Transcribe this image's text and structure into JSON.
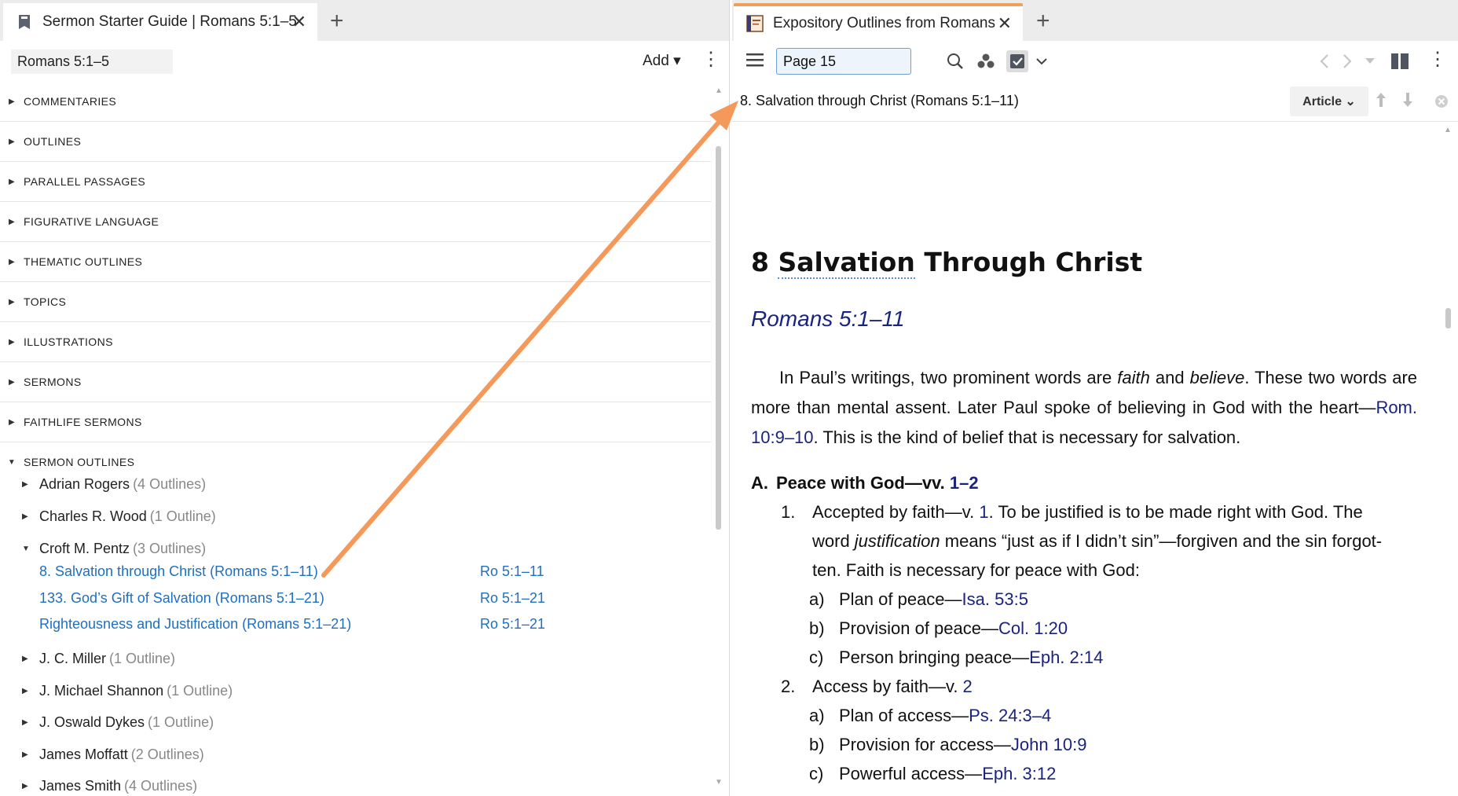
{
  "left": {
    "tab_title": "Sermon Starter Guide | Romans 5:1–5",
    "tab_close": "✕",
    "new_tab": "+",
    "passage": "Romans 5:1–5",
    "add_label": "Add ▾",
    "sections": [
      "COMMENTARIES",
      "OUTLINES",
      "PARALLEL PASSAGES",
      "FIGURATIVE LANGUAGE",
      "THEMATIC OUTLINES",
      "TOPICS",
      "ILLUSTRATIONS",
      "SERMONS",
      "FAITHLIFE SERMONS",
      "SERMON OUTLINES"
    ],
    "authors": [
      {
        "name": "Adrian Rogers",
        "count": "(4 Outlines)"
      },
      {
        "name": "Charles R. Wood",
        "count": "(1 Outline)"
      },
      {
        "name": "Croft M. Pentz",
        "count": "(3 Outlines)"
      },
      {
        "name": "J. C. Miller",
        "count": "(1 Outline)"
      },
      {
        "name": "J. Michael Shannon",
        "count": "(1 Outline)"
      },
      {
        "name": "J. Oswald Dykes",
        "count": "(1 Outline)"
      },
      {
        "name": "James Moffatt",
        "count": "(2 Outlines)"
      },
      {
        "name": "James Smith",
        "count": "(4 Outlines)"
      }
    ],
    "pentz_outlines": [
      {
        "title": "8. Salvation through Christ (Romans 5:1–11)",
        "ref": "Ro 5:1–11"
      },
      {
        "title": "133. God’s Gift of Salvation (Romans 5:1–21)",
        "ref": "Ro 5:1–21"
      },
      {
        "title": "Righteousness and Justification (Romans 5:1–21)",
        "ref": "Ro 5:1–21"
      }
    ]
  },
  "right": {
    "tab_title": "Expository Outlines from Romans",
    "tab_close": "✕",
    "new_tab": "+",
    "page_value": "Page 15",
    "location": "8. Salvation through Christ (Romans 5:1–11)",
    "article_label": "Article ⌄",
    "chapter_num": "8",
    "chapter_word": "Salvation",
    "chapter_rest": "Through Christ",
    "chapter_ref": "Romans 5:1–11",
    "intro": {
      "p1": "In Paul’s writings, two prominent words are ",
      "faith": "faith",
      "and": " and ",
      "believe": "believe",
      "p2": ". These two words are more than mental assent. Later Paul spoke of believing in God with the heart—",
      "ref": "Rom. 10:9–10",
      "p3": ". This is the kind of belief that is necessary for salvation."
    },
    "outline": {
      "A_marker": "A.",
      "A_text": "Peace with God—vv. ",
      "A_ref": "1–2",
      "item1_marker": "1.",
      "item1_a": "Accepted by faith—v. ",
      "item1_ref": "1",
      "item1_b": ". To be justified is to be made right with God. The",
      "item1_line2a": "word ",
      "item1_line2_italic": "justification",
      "item1_line2b": " means “just as if I didn’t sin”—forgiven and the sin forgot-",
      "item1_line3": "ten. Faith is necessary for peace with God:",
      "a1_marker": "a)",
      "a1_text": "Plan of peace—",
      "a1_ref": "Isa. 53:5",
      "b1_marker": "b)",
      "b1_text": "Provision of peace—",
      "b1_ref": "Col. 1:20",
      "c1_marker": "c)",
      "c1_text": "Person bringing peace—",
      "c1_ref": "Eph. 2:14",
      "item2_marker": "2.",
      "item2_a": "Access by faith—v. ",
      "item2_ref": "2",
      "a2_marker": "a)",
      "a2_text": "Plan of access—",
      "a2_ref": "Ps. 24:3–4",
      "b2_marker": "b)",
      "b2_text": "Provision for access—",
      "b2_ref": "John 10:9",
      "c2_marker": "c)",
      "c2_text": "Powerful access—",
      "c2_ref": "Eph. 3:12"
    }
  },
  "colors": {
    "accent_tab": "#f0a05a",
    "link_blue": "#1f6fc1",
    "ref_navy": "#1a237e",
    "arrow": "#f4995a"
  }
}
